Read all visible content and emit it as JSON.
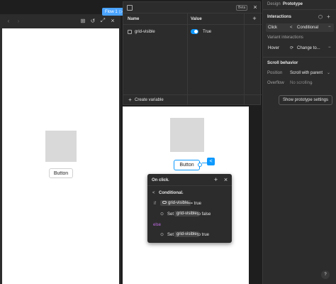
{
  "flow": {
    "label": "Flow 1"
  },
  "preview": {
    "button_label": "Button"
  },
  "variables_panel": {
    "beta_label": "Beta",
    "col_name": "Name",
    "col_value": "Value",
    "row_name": "grid-visible",
    "row_value": "True",
    "create_variable": "Create variable"
  },
  "canvas": {
    "button_label": "Button"
  },
  "popup": {
    "header": "On click",
    "conditional": "Conditional",
    "if_kw": "if",
    "if_var": "grid-visible",
    "if_op": "== true",
    "set1_kw": "Set",
    "set1_var": "grid-visible",
    "set1_to": "to false",
    "else_kw": "else",
    "set2_kw": "Set",
    "set2_var": "grid-visible",
    "set2_to": "to true"
  },
  "sidebar": {
    "tab_design": "Design",
    "tab_prototype": "Prototype",
    "interactions_title": "Interactions",
    "click_trigger": "Click",
    "click_action": "Conditional",
    "variant_interactions": "Variant interactions",
    "hover_trigger": "Hover",
    "hover_action": "Change to...",
    "scroll_behavior": "Scroll behavior",
    "position_label": "Position",
    "position_value": "Scroll with parent",
    "overflow_label": "Overflow",
    "overflow_value": "No scrolling",
    "proto_settings": "Show prototype settings",
    "help": "?"
  },
  "colors": {
    "accent": "#0d99ff",
    "purple": "#c26ce6",
    "canvas": "#ffffff",
    "panel": "#2c2c2c"
  }
}
